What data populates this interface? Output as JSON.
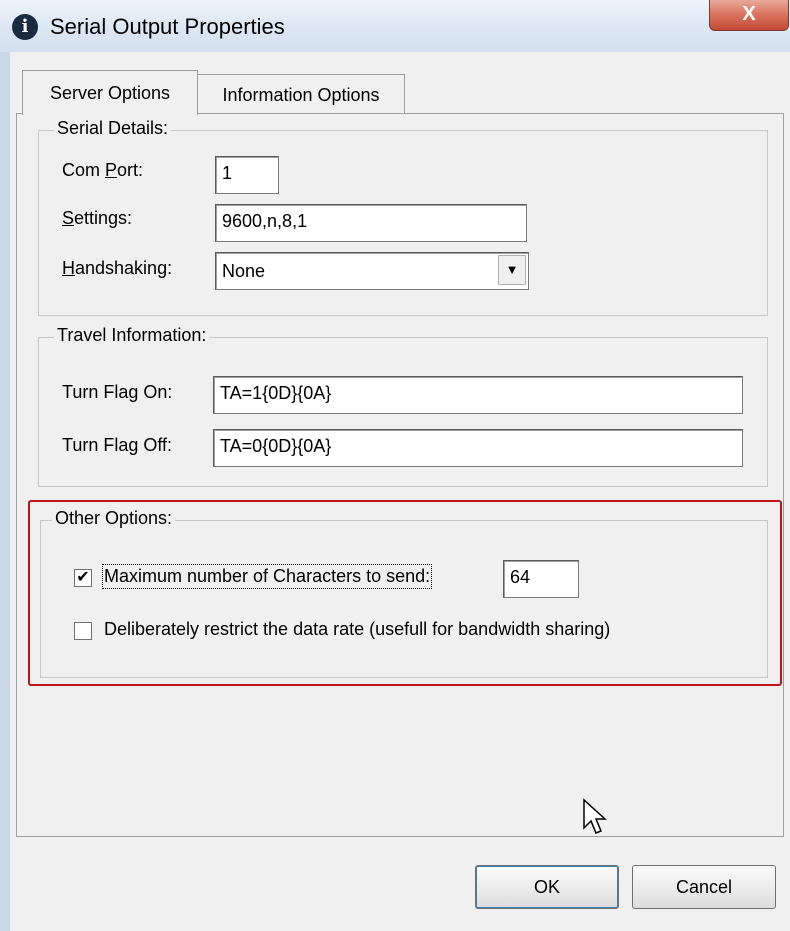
{
  "window": {
    "title": "Serial Output Properties",
    "close_label": "X",
    "icon": "info-icon"
  },
  "tabs": [
    {
      "label": "Server Options",
      "active": true
    },
    {
      "label": "Information Options",
      "active": false
    }
  ],
  "serial_details": {
    "title": "Serial Details:",
    "com_port": {
      "label_pre": "Com ",
      "label_u": "P",
      "label_post": "ort:",
      "value": "1"
    },
    "settings": {
      "label_pre": "",
      "label_u": "S",
      "label_post": "ettings:",
      "value": "9600,n,8,1"
    },
    "handshaking": {
      "label_pre": "",
      "label_u": "H",
      "label_post": "andshaking:",
      "value": "None"
    }
  },
  "travel_information": {
    "title": "Travel Information:",
    "flag_on": {
      "label": "Turn Flag On:",
      "value": "TA=1{0D}{0A}"
    },
    "flag_off": {
      "label": "Turn Flag Off:",
      "value": "TA=0{0D}{0A}"
    }
  },
  "other_options": {
    "title": "Other Options:",
    "max_chars": {
      "checked": true,
      "label": "Maximum number of Characters to send:",
      "value": "64"
    },
    "restrict_rate": {
      "checked": false,
      "label": "Deliberately restrict the data rate (usefull for bandwidth sharing)"
    }
  },
  "buttons": {
    "ok": "OK",
    "cancel": "Cancel"
  },
  "colors": {
    "highlight_border": "#c0141b",
    "close_button": "#c24a35"
  }
}
